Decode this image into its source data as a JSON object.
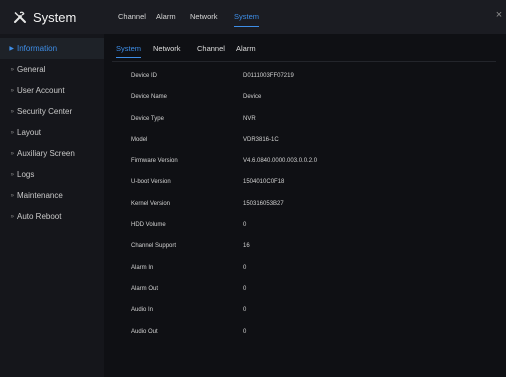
{
  "sidebar": {
    "title": "System",
    "items": [
      {
        "label": "Information"
      },
      {
        "label": "General"
      },
      {
        "label": "User Account"
      },
      {
        "label": "Security Center"
      },
      {
        "label": "Layout"
      },
      {
        "label": "Auxiliary Screen"
      },
      {
        "label": "Logs"
      },
      {
        "label": "Maintenance"
      },
      {
        "label": "Auto Reboot"
      }
    ]
  },
  "header": {
    "tabs": [
      {
        "label": "Channel"
      },
      {
        "label": "Alarm"
      },
      {
        "label": "Network"
      },
      {
        "label": "System"
      }
    ],
    "close_label": "×"
  },
  "main": {
    "subtabs": [
      {
        "label": "System"
      },
      {
        "label": "Network"
      },
      {
        "label": "Channel"
      },
      {
        "label": "Alarm"
      }
    ],
    "info": [
      {
        "label": "Device ID",
        "value": "D0111003FF07219"
      },
      {
        "label": "Device Name",
        "value": "Device"
      },
      {
        "label": "Device Type",
        "value": "NVR"
      },
      {
        "label": "Model",
        "value": "VDR3816-1C"
      },
      {
        "label": "Firmware Version",
        "value": "V4.6.0840.0000.003.0.0.2.0"
      },
      {
        "label": "U-boot Version",
        "value": "1504010C0F18"
      },
      {
        "label": "Kernel Version",
        "value": "150316053B27"
      },
      {
        "label": "HDD Volume",
        "value": "0"
      },
      {
        "label": "Channel Support",
        "value": "16"
      },
      {
        "label": "Alarm In",
        "value": "0"
      },
      {
        "label": "Alarm Out",
        "value": "0"
      },
      {
        "label": "Audio In",
        "value": "0"
      },
      {
        "label": "Audio Out",
        "value": "0"
      }
    ]
  },
  "colors": {
    "accent": "#3e8ee8",
    "background": "#0f1014",
    "sidebar": "#15161b",
    "header": "#1b1c22"
  }
}
